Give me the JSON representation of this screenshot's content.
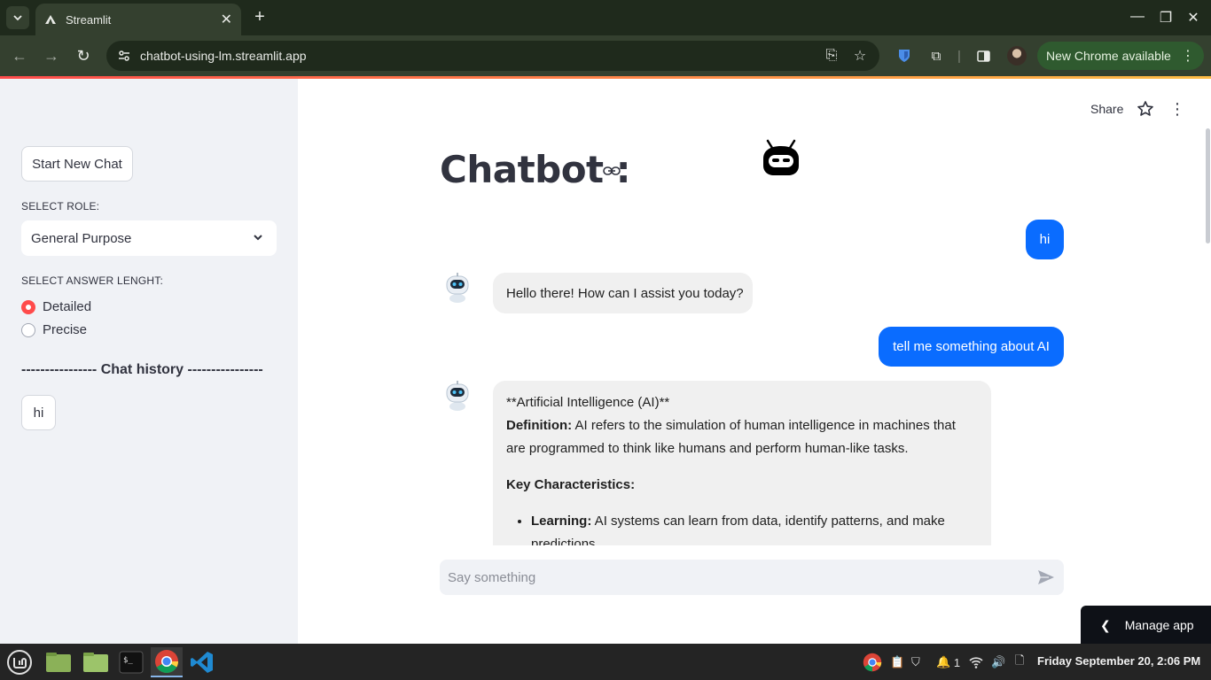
{
  "browser": {
    "tab_title": "Streamlit",
    "url": "chatbot-using-lm.streamlit.app",
    "update_label": "New Chrome available"
  },
  "sidebar": {
    "new_chat_label": "Start New Chat",
    "role_label": "SELECT ROLE:",
    "role_value": "General Purpose",
    "length_label": "SELECT ANSWER LENGHT:",
    "length_options": [
      "Detailed",
      "Precise"
    ],
    "length_selected": "Detailed",
    "history_title": "---------------- Chat history ----------------",
    "history_items": [
      "hi"
    ]
  },
  "header": {
    "share_label": "Share"
  },
  "main": {
    "title": "Chatbot :",
    "messages": [
      {
        "role": "user",
        "text": "hi"
      },
      {
        "role": "assistant",
        "text": "Hello there! How can I assist you today?"
      },
      {
        "role": "user",
        "text": "tell me something about AI"
      }
    ],
    "reply": {
      "heading": "**Artificial Intelligence (AI)**",
      "def_label": "Definition:",
      "def_text": " AI refers to the simulation of human intelligence in machines that are programmed to think like humans and perform human-like tasks.",
      "key_label": "Key Characteristics:",
      "bullet_label": "Learning:",
      "bullet_text": " AI systems can learn from data, identify patterns, and make predictions."
    },
    "input_placeholder": "Say something",
    "manage_app_label": "Manage app"
  },
  "taskbar": {
    "notification_count": "1",
    "clock": "Friday September 20,  2:06 PM"
  },
  "colors": {
    "primary": "#ff4b4b",
    "user_bubble": "#0a6cff",
    "sidebar_bg": "#f0f2f6"
  }
}
